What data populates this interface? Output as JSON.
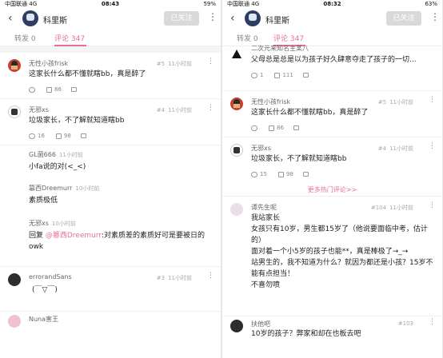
{
  "left": {
    "status": {
      "carrier": "中国联通",
      "network": "4G",
      "time": "08:43",
      "right": "59%"
    },
    "header": {
      "back": "‹",
      "username": "科里斯",
      "follow_label": "已关注",
      "more": "⋮"
    },
    "tabs": {
      "repost": "转发 0",
      "comments": "评论 347"
    },
    "comments": [
      {
        "name": "无性小孩frisk",
        "time": "11小时前",
        "floor": "#5",
        "text": "这家长什么都不懂就瞎bb，真是醉了",
        "comment_count": "",
        "likes": "86",
        "shares": ""
      },
      {
        "name": "无邪xs",
        "time": "11小时前",
        "floor": "#4",
        "text": "垃圾家长，不了解就知道瞎bb",
        "comment_count": "16",
        "likes": "98",
        "shares": ""
      },
      {
        "name": "GL菌666",
        "time": "11小时前",
        "text": "小fa说的对(<_<)"
      },
      {
        "name": "篡西Dreemurr",
        "time": "10小时前",
        "text": "素质极低"
      },
      {
        "name": "无邪xs",
        "time": "10小时前",
        "text_prefix": "回复 ",
        "mention": "@篡西Dreemurr",
        "text_suffix": ":对素质差的素质好可是要被日的",
        "text_line2": "owk"
      },
      {
        "name": "errorandSans",
        "time": "11小时前",
        "floor": "#3",
        "text": "(￣▽￣)"
      },
      {
        "name": "Nuna害王"
      }
    ]
  },
  "right": {
    "status": {
      "carrier": "中国联通",
      "network": "4G",
      "time": "08:32",
      "right": "63%"
    },
    "header": {
      "back": "‹",
      "username": "科里斯",
      "follow_label": "已关注",
      "more": "⋮"
    },
    "tabs": {
      "repost": "转发 0",
      "comments": "评论 347"
    },
    "comments": [
      {
        "name": "二次元来知名主某八",
        "text": "父母总是总是以为孩子好久肆意夺走了孩子的一切...",
        "comment_count": "1",
        "likes": "111",
        "shares": ""
      },
      {
        "name": "无性小孩frisk",
        "time": "11小时前",
        "floor": "#5",
        "text": "这家长什么都不懂就瞎bb，真是醉了",
        "comment_count": "",
        "likes": "86",
        "shares": ""
      },
      {
        "name": "无邪xs",
        "time": "11小时前",
        "floor": "#4",
        "text": "垃圾家长，不了解就知道瞎bb",
        "comment_count": "15",
        "likes": "98",
        "shares": ""
      },
      {
        "name": "谭先生呢",
        "time": "11小时前",
        "floor": "#104",
        "lines": [
          "我站家长",
          "女孩只有10岁，男生都15岁了（他说要面临中考，估计",
          "的）",
          "面对着一个小5岁的孩子也能**，真是棒极了→_→",
          "站男生的，我不知道为什么？就因为都还是小孩？15岁不",
          "能有点担当！",
          "不喜勿喷"
        ]
      },
      {
        "name": "扶他吧",
        "floor": "#103",
        "text": "10岁的孩子？弊家和却在也板去吧"
      }
    ],
    "more_hot": "更多热门评论>>"
  }
}
